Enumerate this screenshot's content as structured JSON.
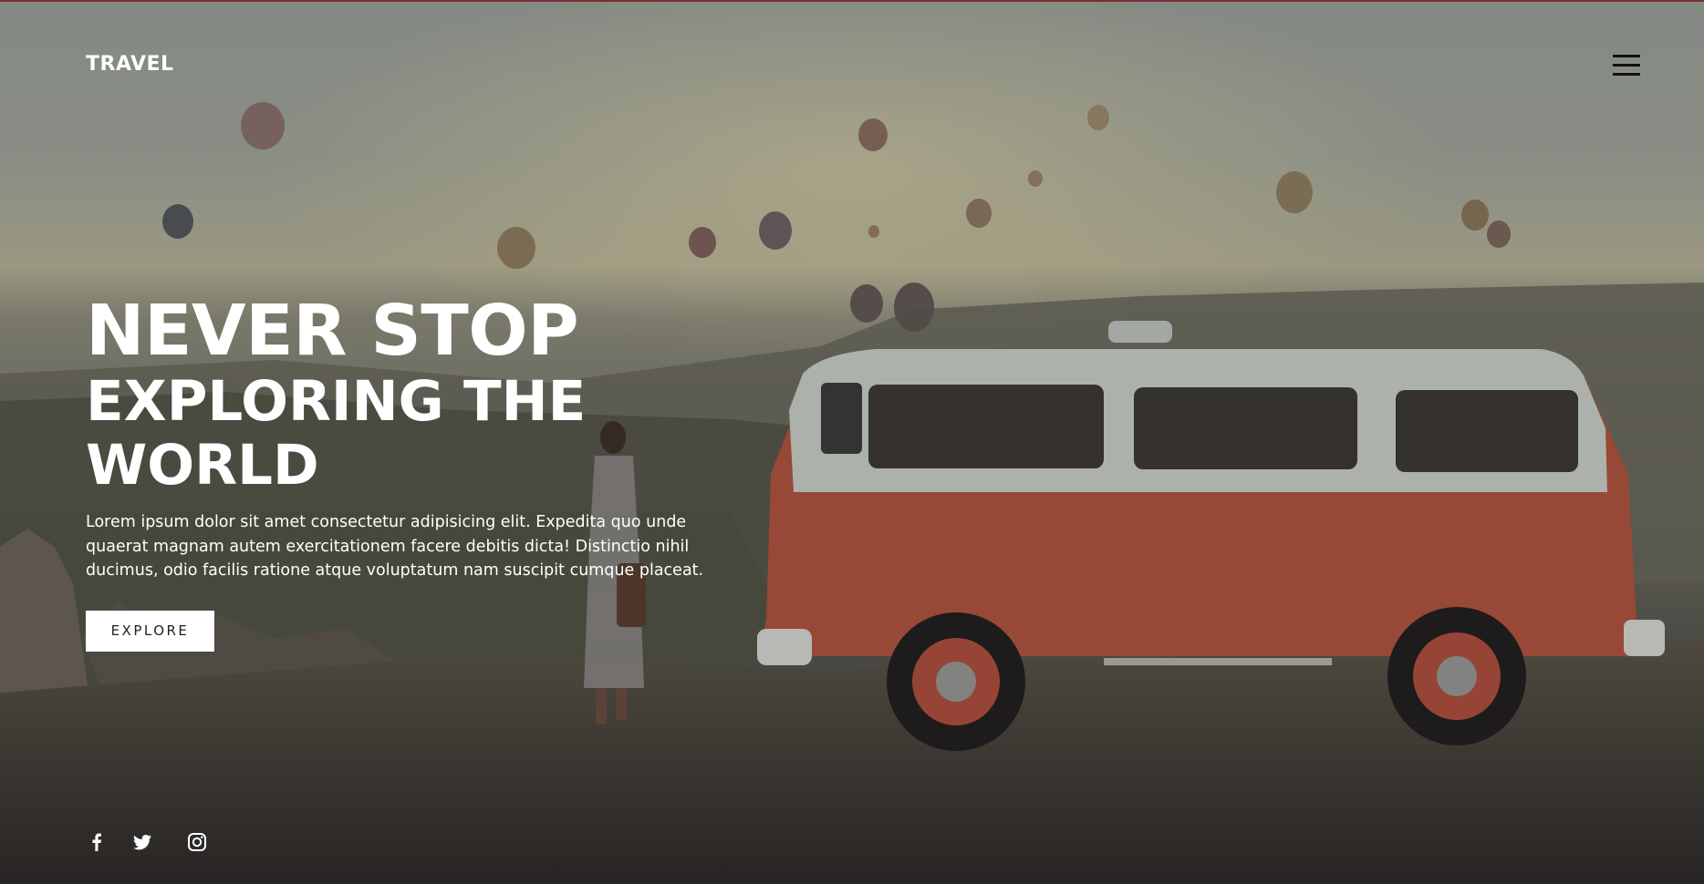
{
  "brand": {
    "name": "TRAVEL"
  },
  "nav": {
    "menu_icon": "hamburger-menu-icon"
  },
  "hero": {
    "headline": "NEVER STOP",
    "subheadline": "EXPLORING THE WORLD",
    "description": "Lorem ipsum dolor sit amet consectetur adipisicing elit. Expedita quo unde quaerat magnam autem exercitationem facere debitis dicta! Distinctio nihil ducimus, odio facilis ratione atque voluptatum nam suscipit cumque placeat.",
    "cta_label": "EXPLORE"
  },
  "social": [
    {
      "icon": "facebook-icon"
    },
    {
      "icon": "twitter-icon"
    },
    {
      "icon": "instagram-icon"
    }
  ],
  "colors": {
    "text": "#ffffff",
    "button_bg": "#ffffff",
    "button_text": "#222222",
    "menu_icon": "#111111",
    "van_body": "#b4543e",
    "van_top": "#cdd3cc"
  }
}
